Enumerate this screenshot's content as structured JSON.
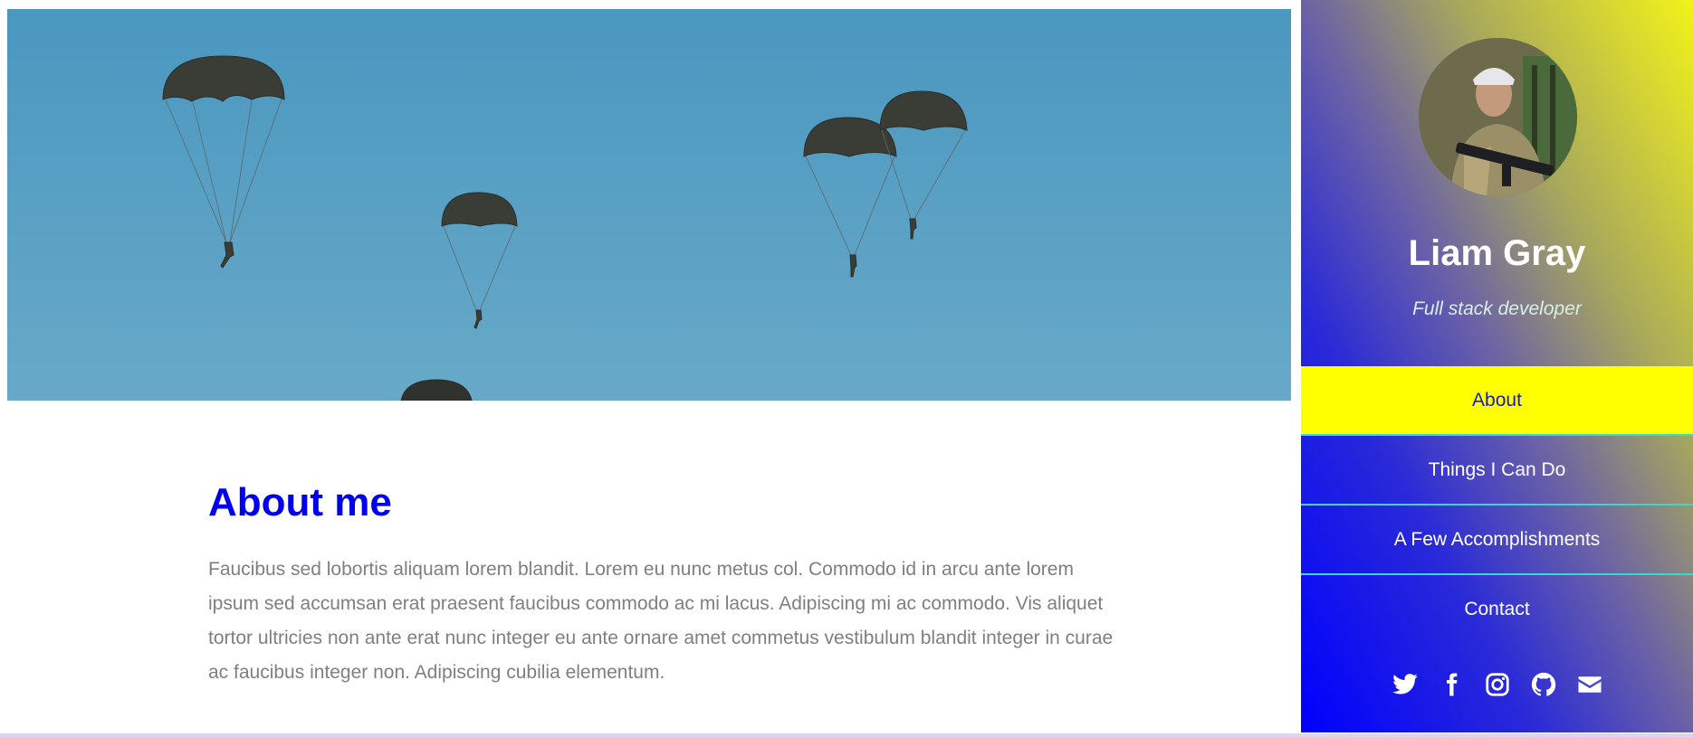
{
  "profile": {
    "name": "Liam Gray",
    "role": "Full stack developer"
  },
  "nav": {
    "items": [
      {
        "label": "About",
        "active": true
      },
      {
        "label": "Things I Can Do",
        "active": false
      },
      {
        "label": "A Few Accomplishments",
        "active": false
      },
      {
        "label": "Contact",
        "active": false
      }
    ]
  },
  "social": {
    "icons": [
      "twitter-icon",
      "facebook-icon",
      "instagram-icon",
      "github-icon",
      "envelope-icon"
    ]
  },
  "about": {
    "heading": "About me",
    "text": "Faucibus sed lobortis aliquam lorem blandit. Lorem eu nunc metus col. Commodo id in arcu ante lorem ipsum sed accumsan erat praesent faucibus commodo ac mi lacus. Adipiscing mi ac commodo. Vis aliquet tortor ultricies non ante erat nunc integer eu ante ornare amet commetus vestibulum blandit integer in curae ac faucibus integer non. Adipiscing cubilia elementum."
  },
  "colors": {
    "accent": "#0000ee",
    "active_nav": "#ffff00",
    "sky": "#4a9ac4"
  }
}
